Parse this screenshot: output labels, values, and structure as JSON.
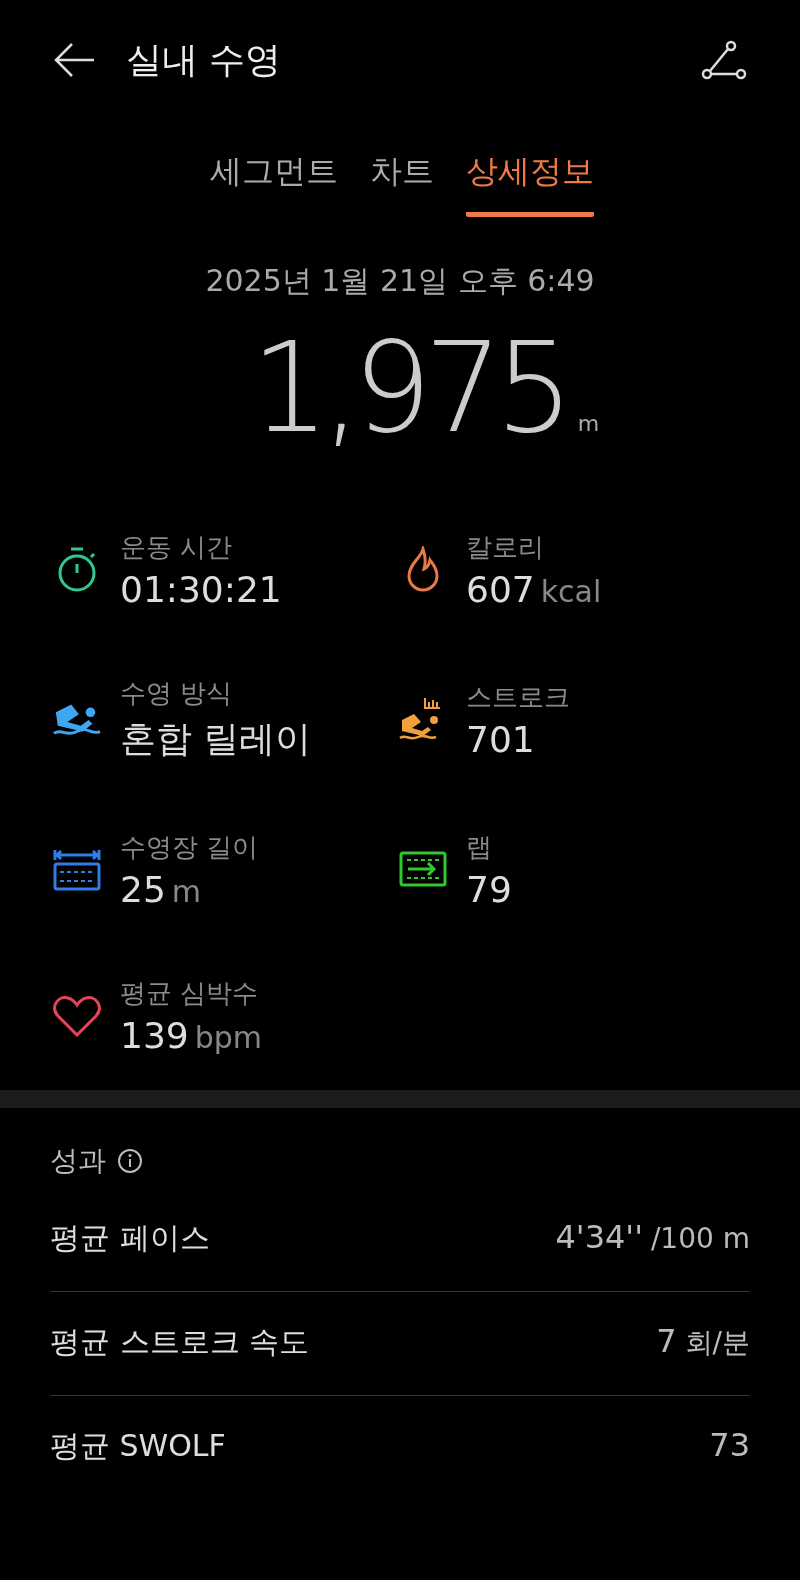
{
  "header": {
    "title": "실내 수영"
  },
  "tabs": [
    {
      "label": "세그먼트",
      "selected": false
    },
    {
      "label": "차트",
      "selected": false
    },
    {
      "label": "상세정보",
      "selected": true
    }
  ],
  "date": "2025년 1월 21일 오후 6:49",
  "distance": {
    "value": "1,975",
    "unit": "m"
  },
  "stats": [
    {
      "kind": "duration",
      "label": "운동 시간",
      "value": "01:30:21"
    },
    {
      "kind": "calories",
      "label": "칼로리",
      "value": "607",
      "unit": "kcal"
    },
    {
      "kind": "style",
      "label": "수영 방식",
      "value": "혼합 릴레이"
    },
    {
      "kind": "strokes",
      "label": "스트로크",
      "value": "701"
    },
    {
      "kind": "pool",
      "label": "수영장 길이",
      "value": "25",
      "unit": "m"
    },
    {
      "kind": "laps",
      "label": "랩",
      "value": "79"
    },
    {
      "kind": "heart",
      "label": "평균 심박수",
      "value": "139",
      "unit": "bpm"
    }
  ],
  "performance": {
    "title": "성과",
    "rows": [
      {
        "label": "평균 페이스",
        "value": "4'34''",
        "unit": "/100 m"
      },
      {
        "label": "평균 스트로크 속도",
        "value": "7",
        "unit": "회/분"
      },
      {
        "label": "평균 SWOLF",
        "value": "73"
      }
    ]
  }
}
